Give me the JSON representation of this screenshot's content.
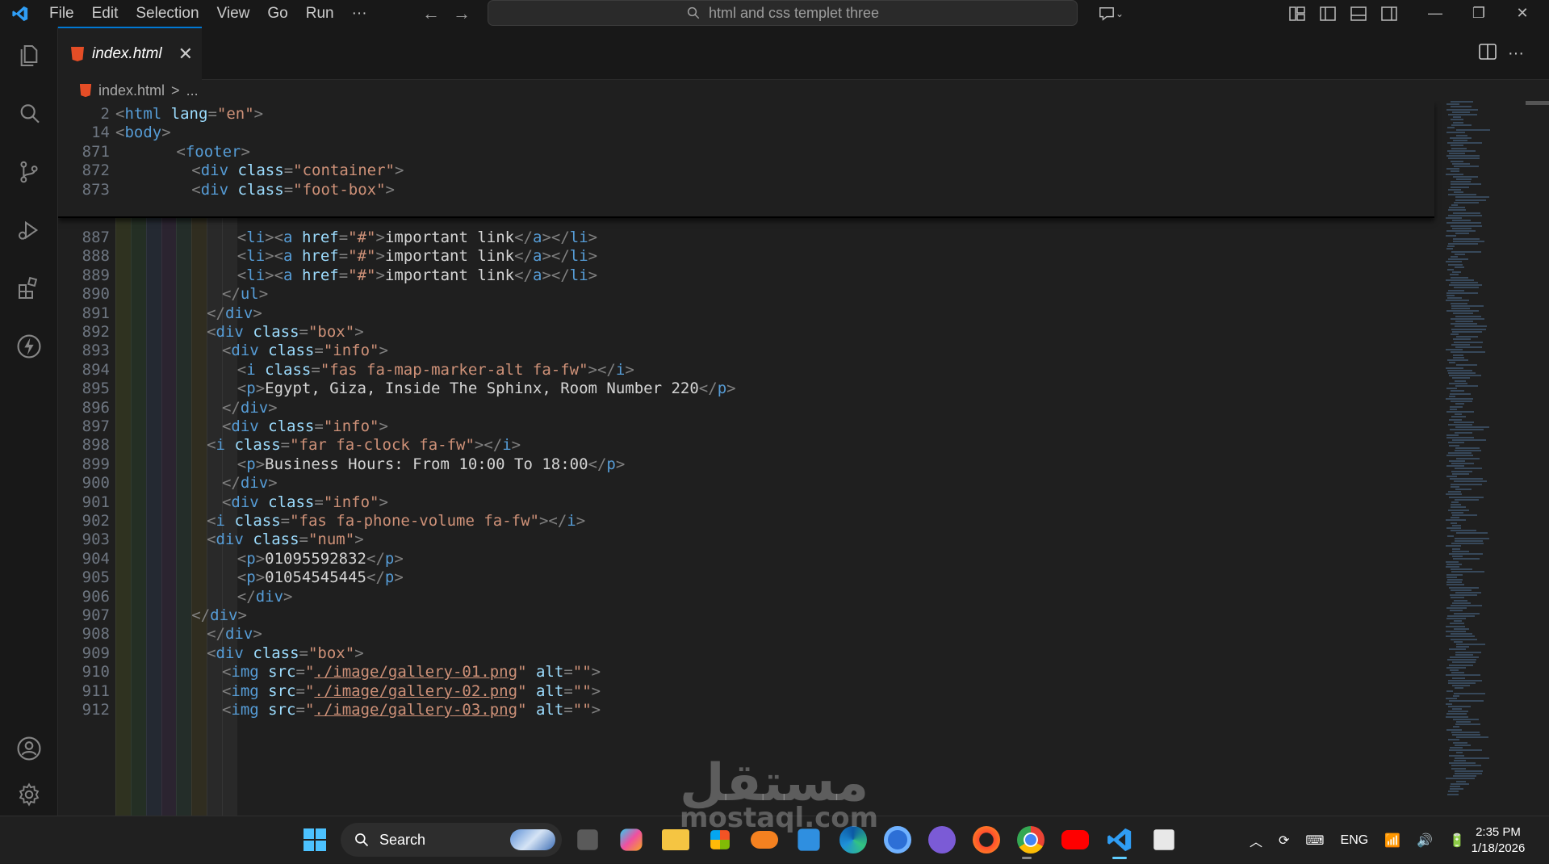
{
  "titlebar": {
    "menu": [
      "File",
      "Edit",
      "Selection",
      "View",
      "Go",
      "Run",
      "···"
    ],
    "search_text": "html and css templet three"
  },
  "tab": {
    "label": "index.html",
    "close": "✕"
  },
  "breadcrumb": {
    "file": "index.html",
    "sep": ">",
    "rest": "..."
  },
  "sticky_lines": [
    {
      "ln": "2",
      "indent": 0,
      "tokens": [
        [
          "punc",
          "<"
        ],
        [
          "tag",
          "html"
        ],
        [
          "sp",
          " "
        ],
        [
          "attr",
          "lang"
        ],
        [
          "punc",
          "="
        ],
        [
          "str",
          "\"en\""
        ],
        [
          "punc",
          ">"
        ]
      ]
    },
    {
      "ln": "14",
      "indent": 0,
      "tokens": [
        [
          "punc",
          "<"
        ],
        [
          "tag",
          "body"
        ],
        [
          "punc",
          ">"
        ]
      ]
    },
    {
      "ln": "871",
      "indent": 4,
      "tokens": [
        [
          "punc",
          "<"
        ],
        [
          "tag",
          "footer"
        ],
        [
          "punc",
          ">"
        ]
      ]
    },
    {
      "ln": "872",
      "indent": 5,
      "tokens": [
        [
          "punc",
          "<"
        ],
        [
          "tag",
          "div"
        ],
        [
          "sp",
          " "
        ],
        [
          "attr",
          "class"
        ],
        [
          "punc",
          "="
        ],
        [
          "str",
          "\"container\""
        ],
        [
          "punc",
          ">"
        ]
      ]
    },
    {
      "ln": "873",
      "indent": 5,
      "tokens": [
        [
          "punc",
          "<"
        ],
        [
          "tag",
          "div"
        ],
        [
          "sp",
          " "
        ],
        [
          "attr",
          "class"
        ],
        [
          "punc",
          "="
        ],
        [
          "str",
          "\"foot-box\""
        ],
        [
          "punc",
          ">"
        ]
      ]
    }
  ],
  "lines": [
    {
      "ln": "887",
      "indent": 8,
      "tokens": [
        [
          "punc",
          "<"
        ],
        [
          "tag",
          "li"
        ],
        [
          "punc",
          "><"
        ],
        [
          "tag",
          "a"
        ],
        [
          "sp",
          " "
        ],
        [
          "attr",
          "href"
        ],
        [
          "punc",
          "="
        ],
        [
          "str",
          "\"#\""
        ],
        [
          "punc",
          ">"
        ],
        [
          "text",
          "important link"
        ],
        [
          "punc",
          "</"
        ],
        [
          "tag",
          "a"
        ],
        [
          "punc",
          "></"
        ],
        [
          "tag",
          "li"
        ],
        [
          "punc",
          ">"
        ]
      ]
    },
    {
      "ln": "888",
      "indent": 8,
      "tokens": [
        [
          "punc",
          "<"
        ],
        [
          "tag",
          "li"
        ],
        [
          "punc",
          "><"
        ],
        [
          "tag",
          "a"
        ],
        [
          "sp",
          " "
        ],
        [
          "attr",
          "href"
        ],
        [
          "punc",
          "="
        ],
        [
          "str",
          "\"#\""
        ],
        [
          "punc",
          ">"
        ],
        [
          "text",
          "important link"
        ],
        [
          "punc",
          "</"
        ],
        [
          "tag",
          "a"
        ],
        [
          "punc",
          "></"
        ],
        [
          "tag",
          "li"
        ],
        [
          "punc",
          ">"
        ]
      ]
    },
    {
      "ln": "889",
      "indent": 8,
      "tokens": [
        [
          "punc",
          "<"
        ],
        [
          "tag",
          "li"
        ],
        [
          "punc",
          "><"
        ],
        [
          "tag",
          "a"
        ],
        [
          "sp",
          " "
        ],
        [
          "attr",
          "href"
        ],
        [
          "punc",
          "="
        ],
        [
          "str",
          "\"#\""
        ],
        [
          "punc",
          ">"
        ],
        [
          "text",
          "important link"
        ],
        [
          "punc",
          "</"
        ],
        [
          "tag",
          "a"
        ],
        [
          "punc",
          "></"
        ],
        [
          "tag",
          "li"
        ],
        [
          "punc",
          ">"
        ]
      ]
    },
    {
      "ln": "890",
      "indent": 7,
      "tokens": [
        [
          "punc",
          "</"
        ],
        [
          "tag",
          "ul"
        ],
        [
          "punc",
          ">"
        ]
      ]
    },
    {
      "ln": "891",
      "indent": 6,
      "tokens": [
        [
          "punc",
          "</"
        ],
        [
          "tag",
          "div"
        ],
        [
          "punc",
          ">"
        ]
      ]
    },
    {
      "ln": "892",
      "indent": 6,
      "tokens": [
        [
          "punc",
          "<"
        ],
        [
          "tag",
          "div"
        ],
        [
          "sp",
          " "
        ],
        [
          "attr",
          "class"
        ],
        [
          "punc",
          "="
        ],
        [
          "str",
          "\"box\""
        ],
        [
          "punc",
          ">"
        ]
      ]
    },
    {
      "ln": "893",
      "indent": 7,
      "tokens": [
        [
          "punc",
          "<"
        ],
        [
          "tag",
          "div"
        ],
        [
          "sp",
          " "
        ],
        [
          "attr",
          "class"
        ],
        [
          "punc",
          "="
        ],
        [
          "str",
          "\"info\""
        ],
        [
          "punc",
          ">"
        ]
      ]
    },
    {
      "ln": "894",
      "indent": 8,
      "tokens": [
        [
          "punc",
          "<"
        ],
        [
          "tag",
          "i"
        ],
        [
          "sp",
          " "
        ],
        [
          "attr",
          "class"
        ],
        [
          "punc",
          "="
        ],
        [
          "str",
          "\"fas fa-map-marker-alt fa-fw\""
        ],
        [
          "punc",
          "></"
        ],
        [
          "tag",
          "i"
        ],
        [
          "punc",
          ">"
        ]
      ]
    },
    {
      "ln": "895",
      "indent": 8,
      "tokens": [
        [
          "punc",
          "<"
        ],
        [
          "tag",
          "p"
        ],
        [
          "punc",
          ">"
        ],
        [
          "text",
          "Egypt, Giza, Inside The Sphinx, Room Number 220"
        ],
        [
          "punc",
          "</"
        ],
        [
          "tag",
          "p"
        ],
        [
          "punc",
          ">"
        ]
      ]
    },
    {
      "ln": "896",
      "indent": 7,
      "tokens": [
        [
          "punc",
          "</"
        ],
        [
          "tag",
          "div"
        ],
        [
          "punc",
          ">"
        ]
      ]
    },
    {
      "ln": "897",
      "indent": 7,
      "tokens": [
        [
          "punc",
          "<"
        ],
        [
          "tag",
          "div"
        ],
        [
          "sp",
          " "
        ],
        [
          "attr",
          "class"
        ],
        [
          "punc",
          "="
        ],
        [
          "str",
          "\"info\""
        ],
        [
          "punc",
          ">"
        ]
      ]
    },
    {
      "ln": "898",
      "indent": 6,
      "tokens": [
        [
          "punc",
          "<"
        ],
        [
          "tag",
          "i"
        ],
        [
          "sp",
          " "
        ],
        [
          "attr",
          "class"
        ],
        [
          "punc",
          "="
        ],
        [
          "str",
          "\"far fa-clock fa-fw\""
        ],
        [
          "punc",
          "></"
        ],
        [
          "tag",
          "i"
        ],
        [
          "punc",
          ">"
        ]
      ]
    },
    {
      "ln": "899",
      "indent": 8,
      "tokens": [
        [
          "punc",
          "<"
        ],
        [
          "tag",
          "p"
        ],
        [
          "punc",
          ">"
        ],
        [
          "text",
          "Business Hours: From 10:00 To 18:00"
        ],
        [
          "punc",
          "</"
        ],
        [
          "tag",
          "p"
        ],
        [
          "punc",
          ">"
        ]
      ]
    },
    {
      "ln": "900",
      "indent": 7,
      "tokens": [
        [
          "punc",
          "</"
        ],
        [
          "tag",
          "div"
        ],
        [
          "punc",
          ">"
        ]
      ]
    },
    {
      "ln": "901",
      "indent": 7,
      "tokens": [
        [
          "punc",
          "<"
        ],
        [
          "tag",
          "div"
        ],
        [
          "sp",
          " "
        ],
        [
          "attr",
          "class"
        ],
        [
          "punc",
          "="
        ],
        [
          "str",
          "\"info\""
        ],
        [
          "punc",
          ">"
        ]
      ]
    },
    {
      "ln": "902",
      "indent": 6,
      "tokens": [
        [
          "punc",
          "<"
        ],
        [
          "tag",
          "i"
        ],
        [
          "sp",
          " "
        ],
        [
          "attr",
          "class"
        ],
        [
          "punc",
          "="
        ],
        [
          "str",
          "\"fas fa-phone-volume fa-fw\""
        ],
        [
          "punc",
          "></"
        ],
        [
          "tag",
          "i"
        ],
        [
          "punc",
          ">"
        ]
      ]
    },
    {
      "ln": "903",
      "indent": 6,
      "tokens": [
        [
          "punc",
          "<"
        ],
        [
          "tag",
          "div"
        ],
        [
          "sp",
          " "
        ],
        [
          "attr",
          "class"
        ],
        [
          "punc",
          "="
        ],
        [
          "str",
          "\"num\""
        ],
        [
          "punc",
          ">"
        ]
      ]
    },
    {
      "ln": "904",
      "indent": 8,
      "tokens": [
        [
          "punc",
          "<"
        ],
        [
          "tag",
          "p"
        ],
        [
          "punc",
          ">"
        ],
        [
          "text",
          "01095592832"
        ],
        [
          "punc",
          "</"
        ],
        [
          "tag",
          "p"
        ],
        [
          "punc",
          ">"
        ]
      ]
    },
    {
      "ln": "905",
      "indent": 8,
      "tokens": [
        [
          "punc",
          "<"
        ],
        [
          "tag",
          "p"
        ],
        [
          "punc",
          ">"
        ],
        [
          "text",
          "01054545445"
        ],
        [
          "punc",
          "</"
        ],
        [
          "tag",
          "p"
        ],
        [
          "punc",
          ">"
        ]
      ]
    },
    {
      "ln": "906",
      "indent": 8,
      "tokens": [
        [
          "punc",
          "</"
        ],
        [
          "tag",
          "div"
        ],
        [
          "punc",
          ">"
        ]
      ]
    },
    {
      "ln": "907",
      "indent": 5,
      "tokens": [
        [
          "punc",
          "</"
        ],
        [
          "tag",
          "div"
        ],
        [
          "punc",
          ">"
        ]
      ]
    },
    {
      "ln": "908",
      "indent": 6,
      "tokens": [
        [
          "punc",
          "</"
        ],
        [
          "tag",
          "div"
        ],
        [
          "punc",
          ">"
        ]
      ]
    },
    {
      "ln": "909",
      "indent": 6,
      "tokens": [
        [
          "punc",
          "<"
        ],
        [
          "tag",
          "div"
        ],
        [
          "sp",
          " "
        ],
        [
          "attr",
          "class"
        ],
        [
          "punc",
          "="
        ],
        [
          "str",
          "\"box\""
        ],
        [
          "punc",
          ">"
        ]
      ]
    },
    {
      "ln": "910",
      "indent": 7,
      "tokens": [
        [
          "punc",
          "<"
        ],
        [
          "tag",
          "img"
        ],
        [
          "sp",
          " "
        ],
        [
          "attr",
          "src"
        ],
        [
          "punc",
          "="
        ],
        [
          "str",
          "\""
        ],
        [
          "link",
          "./image/gallery-01.png"
        ],
        [
          "str",
          "\""
        ],
        [
          "sp",
          " "
        ],
        [
          "attr",
          "alt"
        ],
        [
          "punc",
          "="
        ],
        [
          "str",
          "\"\""
        ],
        [
          "punc",
          ">"
        ]
      ]
    },
    {
      "ln": "911",
      "indent": 7,
      "tokens": [
        [
          "punc",
          "<"
        ],
        [
          "tag",
          "img"
        ],
        [
          "sp",
          " "
        ],
        [
          "attr",
          "src"
        ],
        [
          "punc",
          "="
        ],
        [
          "str",
          "\""
        ],
        [
          "link",
          "./image/gallery-02.png"
        ],
        [
          "str",
          "\""
        ],
        [
          "sp",
          " "
        ],
        [
          "attr",
          "alt"
        ],
        [
          "punc",
          "="
        ],
        [
          "str",
          "\"\""
        ],
        [
          "punc",
          ">"
        ]
      ]
    },
    {
      "ln": "912",
      "indent": 7,
      "tokens": [
        [
          "punc",
          "<"
        ],
        [
          "tag",
          "img"
        ],
        [
          "sp",
          " "
        ],
        [
          "attr",
          "src"
        ],
        [
          "punc",
          "="
        ],
        [
          "str",
          "\""
        ],
        [
          "link",
          "./image/gallery-03.png"
        ],
        [
          "str",
          "\""
        ],
        [
          "sp",
          " "
        ],
        [
          "attr",
          "alt"
        ],
        [
          "punc",
          "="
        ],
        [
          "str",
          "\"\""
        ],
        [
          "punc",
          ">"
        ]
      ]
    }
  ],
  "taskbar": {
    "search_label": "Search",
    "language": "ENG",
    "time": "2:35 PM",
    "date": "1/18/2026"
  },
  "watermark": {
    "arabic": "مستقل",
    "latin": "mostaql.com"
  },
  "colors": {
    "accent": "#0078d4",
    "tag": "#569cd6",
    "attr": "#9cdcfe",
    "string": "#ce9178",
    "text": "#d4d4d4",
    "punctuation": "#808080",
    "line_number": "#6e7681",
    "html5": "#e44d26"
  }
}
